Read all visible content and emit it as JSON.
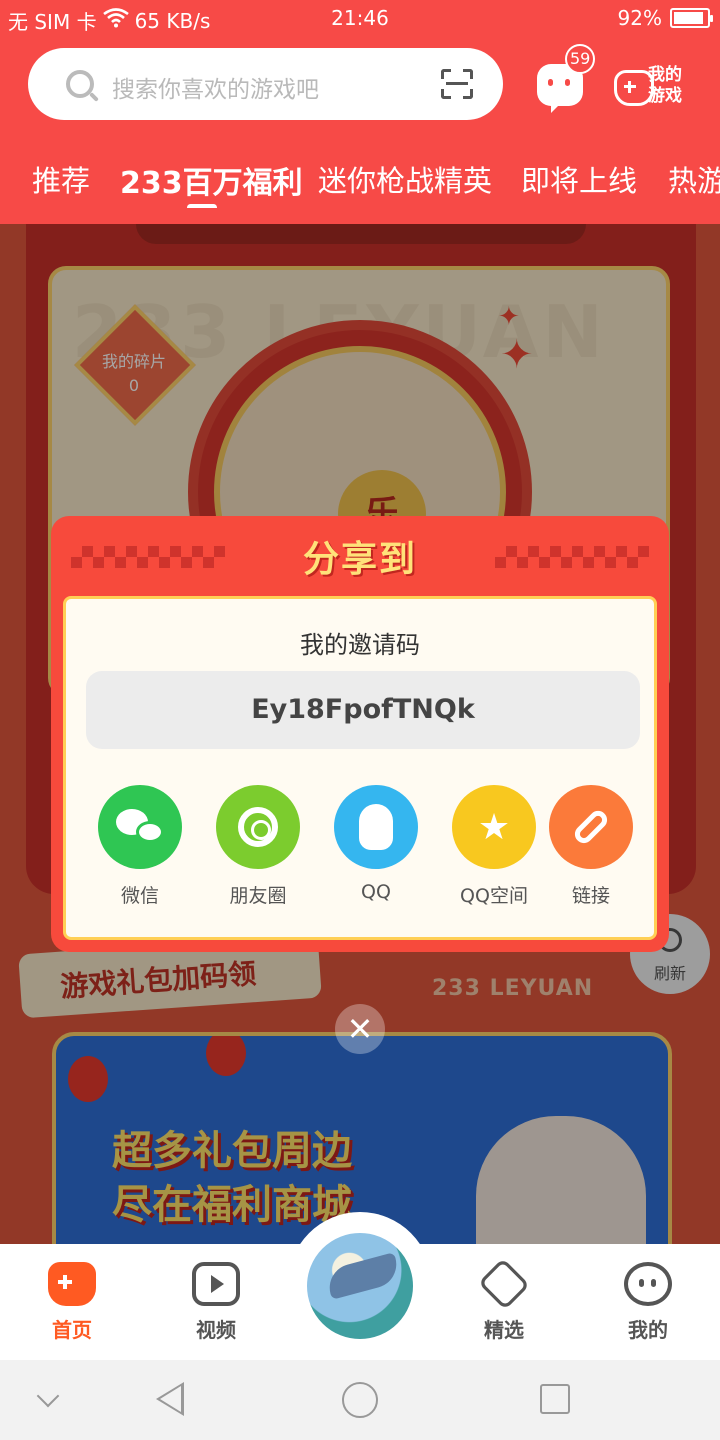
{
  "status_bar": {
    "carrier": "无 SIM 卡",
    "speed": "65 KB/s",
    "time": "21:46",
    "battery": "92%",
    "battery_level": 0.92
  },
  "header": {
    "search_placeholder": "搜索你喜欢的游戏吧",
    "message_badge": "59",
    "my_games_label": "我的游戏",
    "tabs": [
      "推荐",
      "233百万福利",
      "迷你枪战精英",
      "即将上线",
      "热游"
    ],
    "active_tab_index": 1
  },
  "background": {
    "watermark": "233 LEYUAN",
    "fragments_label": "我的碎片",
    "fragments_count": "0",
    "wheel_hub": "乐",
    "gift_section_title": "游戏礼包加码领",
    "brand_line": "233 LEYUAN",
    "promo_line1": "超多礼包周边",
    "promo_line2": "尽在福利商城",
    "refresh_label": "刷新"
  },
  "share_dialog": {
    "title": "分享到",
    "invite_label": "我的邀请码",
    "invite_code": "Ey18FpofTNQk",
    "options": [
      {
        "label": "微信",
        "icon": "wechat-icon",
        "color": "#2fc653"
      },
      {
        "label": "朋友圈",
        "icon": "moments-icon",
        "color": "#7ccc2e"
      },
      {
        "label": "QQ",
        "icon": "qq-icon",
        "color": "#35b6ef"
      },
      {
        "label": "QQ空间",
        "icon": "qzone-icon",
        "color": "#f8c81f"
      },
      {
        "label": "链接",
        "icon": "link-icon",
        "color": "#fb7a3a"
      }
    ],
    "close_glyph": "✕"
  },
  "bottom_nav": {
    "items": [
      {
        "label": "首页",
        "active": true
      },
      {
        "label": "视频",
        "active": false
      },
      {
        "label": "精选",
        "active": false
      },
      {
        "label": "我的",
        "active": false
      }
    ]
  },
  "colors": {
    "brand_red": "#f74a47",
    "active_orange": "#ff5a22"
  }
}
